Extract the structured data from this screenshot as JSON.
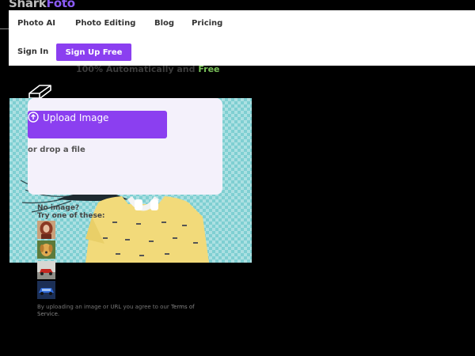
{
  "brand": {
    "part1": "Shark",
    "part2": "Foto"
  },
  "nav": {
    "items": [
      {
        "label": "Photo AI"
      },
      {
        "label": "Photo Editing"
      },
      {
        "label": "Blog"
      },
      {
        "label": "Pricing"
      }
    ],
    "sign_in": "Sign In",
    "sign_up": "Sign Up Free"
  },
  "headline": {
    "text": "100% Automatically and ",
    "highlight": "Free"
  },
  "upload": {
    "button_label": "Upload Image",
    "drop_text": "or drop a file"
  },
  "samples": {
    "line1": "No image?",
    "line2": "Try one of these:",
    "items": [
      "sample-woman",
      "sample-dog",
      "sample-car-red",
      "sample-car-blue"
    ]
  },
  "terms": {
    "text": "By uploading an image or URL you agree to our ",
    "link": "Terms of Service",
    "end": "."
  },
  "colors": {
    "accent": "#8b3ff0",
    "free_green": "#7ac25a",
    "teal_bg": "#7fcfd2",
    "shirt_yellow": "#f2da7a"
  }
}
